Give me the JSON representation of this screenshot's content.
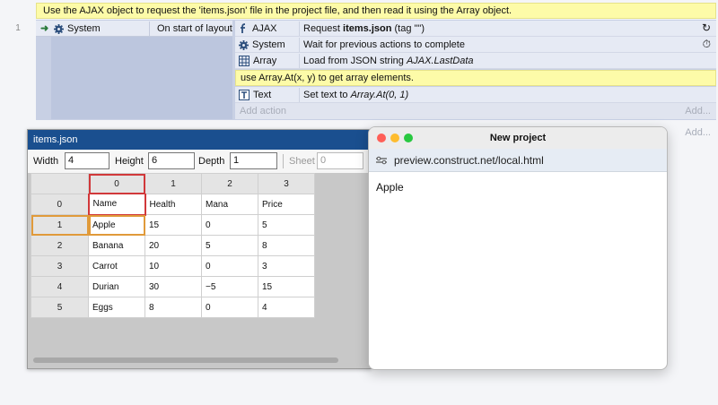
{
  "event_sheet": {
    "top_comment": "Use the AJAX object to request the 'items.json' file in the project file, and then read it using the Array object.",
    "row_number": "1",
    "condition": {
      "object": "System",
      "text": "On start of layout",
      "arrow": "➜"
    },
    "actions": [
      {
        "object": "AJAX",
        "icon": "ajax-icon",
        "prefix": "Request ",
        "bold": "items.json",
        "suffix": " (tag \"\")",
        "right_icon": "↻"
      },
      {
        "object": "System",
        "icon": "gear-icon",
        "prefix": "Wait for previous actions to complete",
        "bold": "",
        "suffix": "",
        "right_icon": "⏱"
      },
      {
        "object": "Array",
        "icon": "array-icon",
        "prefix": "Load from JSON string ",
        "italic": "AJAX.LastData",
        "bold": "",
        "suffix": ""
      }
    ],
    "action_comment": "use Array.At(x, y) to get array elements.",
    "text_action": {
      "object": "Text",
      "prefix": "Set text to ",
      "italic": "Array.At(0, 1)"
    },
    "add_action": "Add action",
    "add_right_1": "Add...",
    "add_right_2": "Add..."
  },
  "array_editor": {
    "title": "items.json",
    "width_label": "Width",
    "width_value": "4",
    "height_label": "Height",
    "height_value": "6",
    "depth_label": "Depth",
    "depth_value": "1",
    "sheet_label": "Sheet",
    "sheet_value": "0",
    "column_headers": [
      "0",
      "1",
      "2",
      "3"
    ],
    "rows": [
      {
        "index": "0",
        "cells": [
          "Name",
          "Health",
          "Mana",
          "Price"
        ]
      },
      {
        "index": "1",
        "cells": [
          "Apple",
          "15",
          "0",
          "5"
        ]
      },
      {
        "index": "2",
        "cells": [
          "Banana",
          "20",
          "5",
          "8"
        ]
      },
      {
        "index": "3",
        "cells": [
          "Carrot",
          "10",
          "0",
          "3"
        ]
      },
      {
        "index": "4",
        "cells": [
          "Durian",
          "30",
          "−5",
          "15"
        ]
      },
      {
        "index": "5",
        "cells": [
          "Eggs",
          "8",
          "0",
          "4"
        ]
      }
    ]
  },
  "preview": {
    "title": "New project",
    "url": "preview.construct.net/local.html",
    "content": "Apple",
    "colors": {
      "close": "#ff5f57",
      "min": "#febc2e",
      "max": "#28c840"
    }
  }
}
